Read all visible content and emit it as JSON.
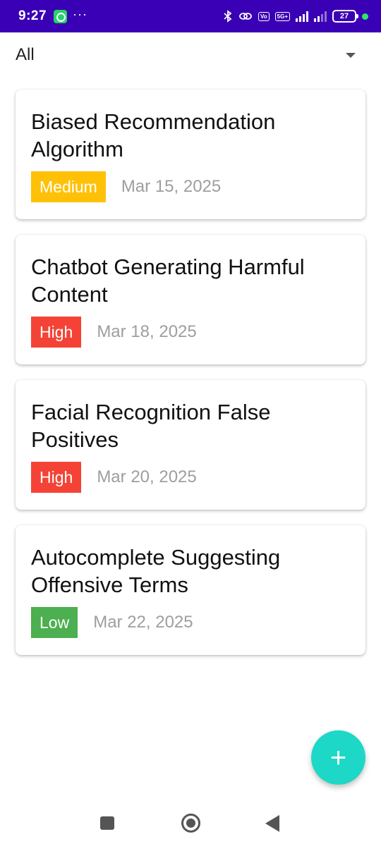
{
  "status_bar": {
    "time": "9:27",
    "overflow": "···",
    "network_badge": "5G+",
    "volte_badge": "Vo",
    "battery": "27",
    "icons": [
      "whatsapp-icon",
      "bluetooth-icon",
      "link-icon",
      "signal-icon",
      "battery-icon"
    ]
  },
  "filter": {
    "selected": "All"
  },
  "reports": [
    {
      "title": "Biased Recommendation Algorithm",
      "severity": "Medium",
      "severity_color": "#ffc107",
      "date": "Mar 15, 2025"
    },
    {
      "title": "Chatbot Generating Harmful Content",
      "severity": "High",
      "severity_color": "#f44336",
      "date": "Mar 18, 2025"
    },
    {
      "title": "Facial Recognition False Positives",
      "severity": "High",
      "severity_color": "#f44336",
      "date": "Mar 20, 2025"
    },
    {
      "title": "Autocomplete Suggesting Offensive Terms",
      "severity": "Low",
      "severity_color": "#4caf50",
      "date": "Mar 22, 2025"
    }
  ],
  "fab": {
    "icon": "plus-icon",
    "glyph": "+",
    "color": "#1dd8c6"
  },
  "colors": {
    "status_bar": "#3a00b5",
    "accent": "#1dd8c6"
  }
}
